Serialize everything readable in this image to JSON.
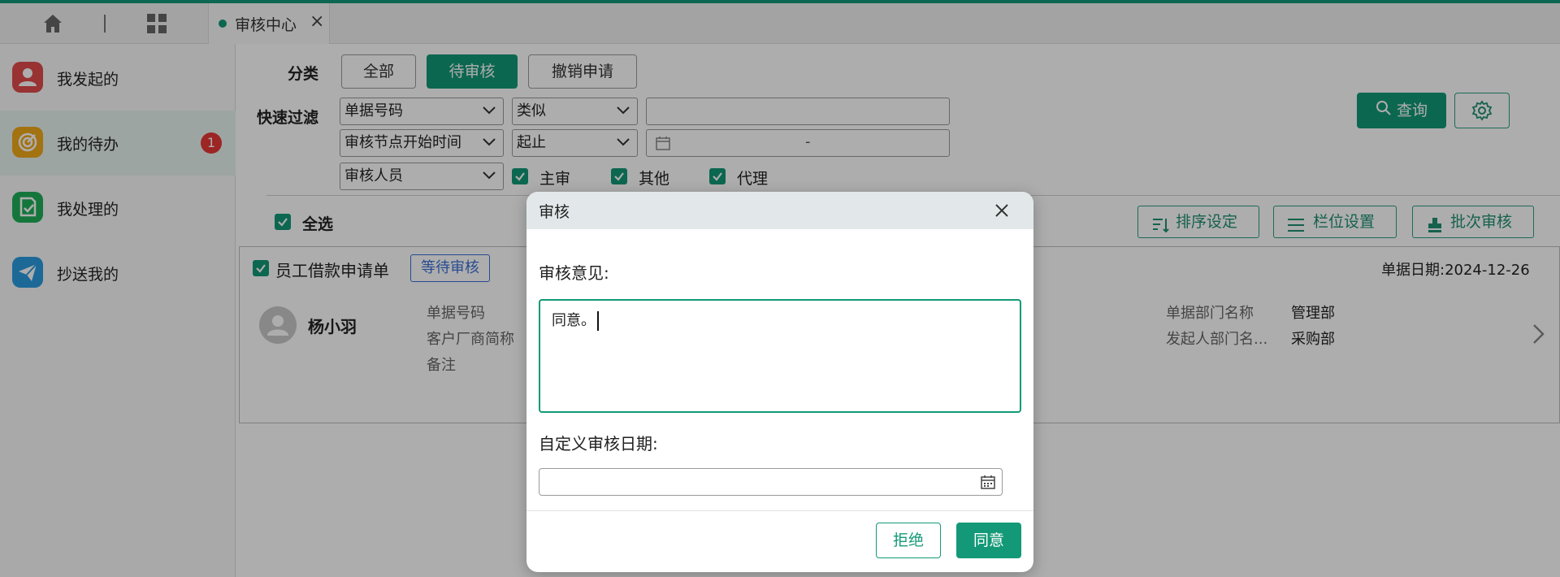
{
  "tabs": {
    "active_label": "审核中心",
    "close": "×"
  },
  "sidebar": {
    "items": [
      {
        "label": "我发起的",
        "color": "#e24b4b"
      },
      {
        "label": "我的待办",
        "color": "#f0a81a",
        "badge": "1"
      },
      {
        "label": "我处理的",
        "color": "#1fae59"
      },
      {
        "label": "抄送我的",
        "color": "#2a9be0"
      }
    ]
  },
  "filters": {
    "category_label": "分类",
    "categories": [
      "全部",
      "待审核",
      "撤销申请"
    ],
    "quick_filter_label": "快速过滤",
    "row1": {
      "field": "单据号码",
      "op": "类似",
      "value": ""
    },
    "row2": {
      "field": "审核节点开始时间",
      "op": "起止",
      "range_sep": "-"
    },
    "row3": {
      "field": "审核人员"
    },
    "checks": [
      "主审",
      "其他",
      "代理"
    ],
    "query_label": "查询"
  },
  "toolbar": {
    "select_all": "全选",
    "sort": "排序设定",
    "columns": "栏位设置",
    "batch": "批次审核"
  },
  "card": {
    "title": "员工借款申请单",
    "status": "等待审核",
    "date": "单据日期:2024-12-26",
    "person": "杨小羽",
    "fields": [
      "单据号码",
      "客户厂商简称",
      "备注"
    ],
    "right_fields": [
      {
        "label": "单据部门名称",
        "value": "管理部"
      },
      {
        "label": "发起人部门名...",
        "value": "采购部"
      }
    ]
  },
  "dialog": {
    "title": "审核",
    "opinion_label": "审核意见:",
    "opinion_value": "同意。",
    "date_label": "自定义审核日期:",
    "date_value": "",
    "reject": "拒绝",
    "agree": "同意"
  },
  "colors": {
    "accent": "#139977",
    "status_blue": "#3b6fd6"
  }
}
